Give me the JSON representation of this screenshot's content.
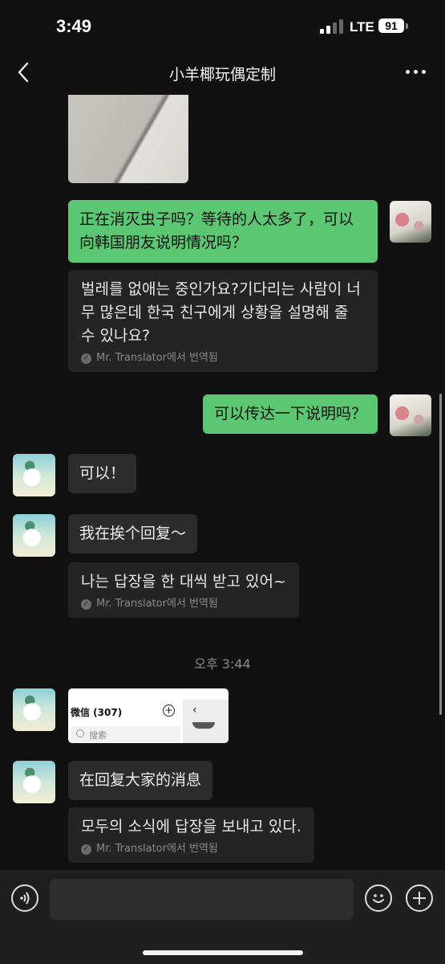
{
  "status_bar": {
    "time": "3:49",
    "network": "LTE",
    "battery": "91"
  },
  "header": {
    "title": "小羊椰玩偶定制",
    "back_icon": "chevron-left-icon",
    "more_icon": "more-dots-icon"
  },
  "messages": [
    {
      "from": "me",
      "text": "正在消灭虫子吗？等待的人太多了，可以向韩国朋友说明情况吗？",
      "translation": "벌레를 없애는 중인가요?기다리는 사람이 너무 많은데 한국 친구에게 상황을 설명해 줄 수 있나요?",
      "translation_source": "Mr. Translator에서 번역됨"
    },
    {
      "from": "me",
      "text": "可以传达一下说明吗？"
    },
    {
      "from": "them",
      "text": "可以！"
    },
    {
      "from": "them",
      "text": "我在挨个回复～",
      "translation": "나는 답장을 한 대씩 받고 있어~",
      "translation_source": "Mr. Translator에서 번역됨"
    },
    {
      "from": "them",
      "type": "timestamp",
      "text": "오후 3:44"
    },
    {
      "from": "them",
      "type": "image",
      "screenshot": {
        "title": "微信 (307)",
        "search_placeholder": "搜索"
      }
    },
    {
      "from": "them",
      "text": "在回复大家的消息",
      "translation": "모두의 소식에 답장을 보내고 있다.",
      "translation_source": "Mr. Translator에서 번역됨"
    }
  ],
  "input_bar": {
    "voice_icon": "voice-icon",
    "emoji_icon": "emoji-icon",
    "plus_icon": "plus-icon",
    "value": ""
  }
}
